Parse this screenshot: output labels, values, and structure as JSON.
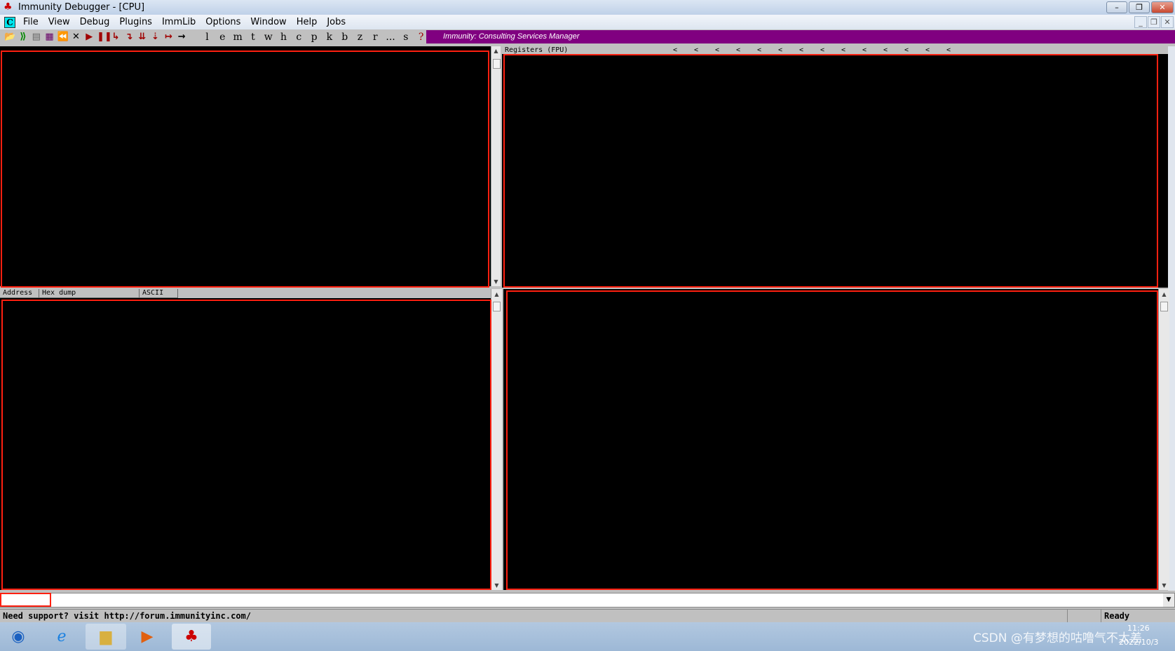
{
  "window": {
    "title": "Immunity Debugger - [CPU]",
    "min": "–",
    "max": "❐",
    "close": "✕"
  },
  "menu": {
    "mdi_icon": "C",
    "items": [
      "File",
      "View",
      "Debug",
      "Plugins",
      "ImmLib",
      "Options",
      "Window",
      "Help",
      "Jobs"
    ]
  },
  "toolbar": {
    "icons": [
      "open-icon",
      "attach-icon",
      "close-window-icon",
      "memory-map-icon",
      "rewind-icon",
      "stop-icon",
      "run-icon",
      "pause-icon",
      "step-into-icon",
      "step-over-icon",
      "trace-into-icon",
      "trace-over-icon",
      "execute-till-return-icon",
      "go-to-icon"
    ],
    "glyphs": [
      "⏪",
      "✕",
      "▶",
      "❚❚",
      "↳",
      "↴",
      "⇊",
      "⇣",
      "↦",
      "→"
    ],
    "letters": [
      "l",
      "e",
      "m",
      "t",
      "w",
      "h",
      "c",
      "p",
      "k",
      "b",
      "z",
      "r",
      "...",
      "s",
      "?"
    ]
  },
  "banner": "Immunity: Consulting Services Manager",
  "registers": {
    "header": "Registers (FPU)",
    "markers": [
      "<",
      "<",
      "<",
      "<",
      "<",
      "<",
      "<",
      "<",
      "<",
      "<",
      "<",
      "<",
      "<",
      "<"
    ]
  },
  "dump": {
    "columns": [
      "Address",
      "Hex dump",
      "ASCII"
    ]
  },
  "status": {
    "message": "Need support? visit http://forum.immunityinc.com/",
    "state": "Ready"
  },
  "taskbar": {
    "watermark": "CSDN @有梦想的咕噜气不太差",
    "time": "11:26",
    "date": "2022/10/3"
  },
  "colors": {
    "banner": "#800080",
    "highlight": "#ff2010",
    "pane": "#000000"
  }
}
